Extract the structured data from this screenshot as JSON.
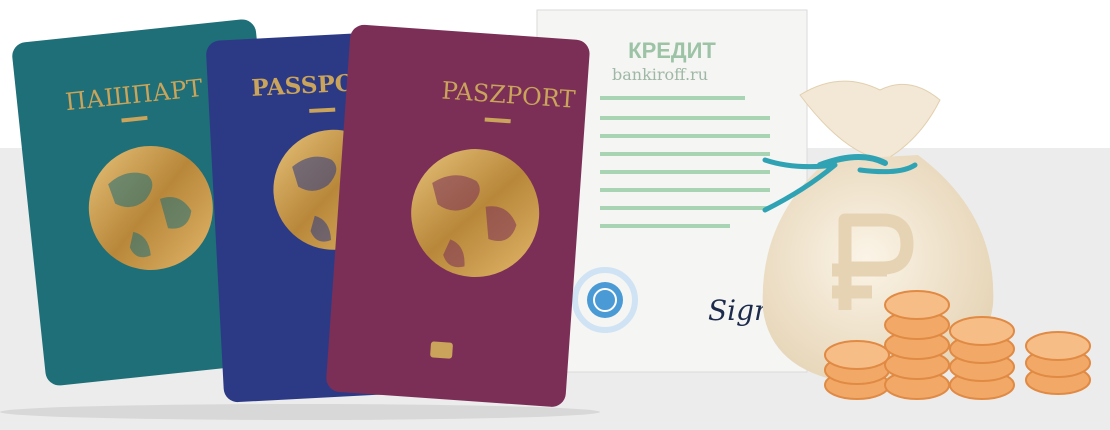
{
  "document": {
    "title": "КРЕДИТ",
    "watermark": "bankiroff.ru",
    "signature": "Sign"
  },
  "passports": [
    {
      "title": "ПАШПАРТ",
      "color": "#1f6f78"
    },
    {
      "title": "PASSPORT",
      "color": "#2c3a86"
    },
    {
      "title": "PASZPORT",
      "color": "#7b2f57"
    }
  ],
  "colors": {
    "gold": "#c9a45a",
    "background_band": "#ececec",
    "rope": "#2fa3b3",
    "coin": "#f2a968",
    "bag": "#f3e8d5",
    "stamp": "#3b8fd1"
  },
  "icons": [
    "globe-icon",
    "chip-icon",
    "ruble-icon",
    "stamp-icon",
    "coin-icon"
  ]
}
